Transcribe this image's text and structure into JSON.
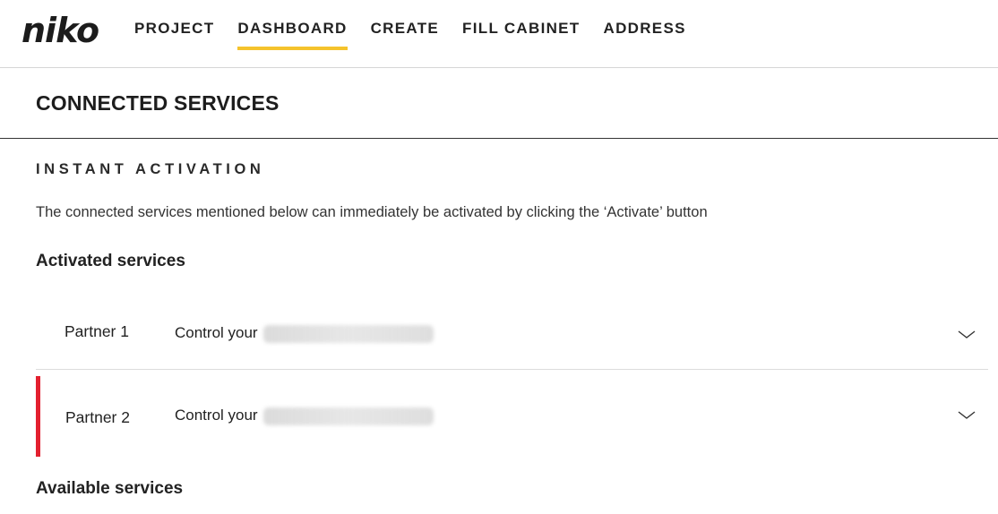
{
  "brand": {
    "logo_text": "niko"
  },
  "nav": {
    "items": [
      {
        "label": "PROJECT",
        "active": false
      },
      {
        "label": "DASHBOARD",
        "active": true
      },
      {
        "label": "CREATE",
        "active": false
      },
      {
        "label": "FILL CABINET",
        "active": false
      },
      {
        "label": "ADDRESS",
        "active": false
      }
    ],
    "active_underline_color": "#f5c32c"
  },
  "page": {
    "title": "CONNECTED SERVICES",
    "instant": {
      "heading": "INSTANT ACTIVATION",
      "description": "The connected services mentioned below can immediately be activated by clicking the ‘Activate’ button"
    },
    "activated_heading": "Activated services",
    "activated_services": [
      {
        "partner": "Partner 1",
        "text": "Control your",
        "icon": "chevron-down-icon"
      },
      {
        "partner": "Partner 2",
        "text": "Control your",
        "icon": "chevron-down-icon",
        "accent_color": "#e3202f"
      }
    ],
    "available_heading": "Available services"
  }
}
